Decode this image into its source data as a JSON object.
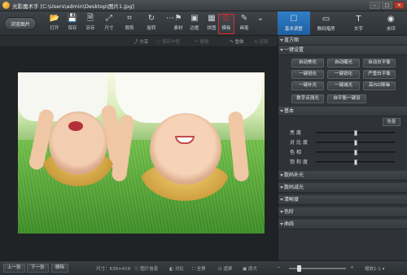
{
  "window": {
    "title": "光影魔术手 [C:\\Users\\admin\\Desktop\\图片1.jpg]",
    "controls": [
      "–",
      "□",
      "×"
    ]
  },
  "toolbar": {
    "browse_label": "浏览图片",
    "tools": [
      {
        "label": "打开",
        "icon": "folder-icon",
        "glyph": "📂"
      },
      {
        "label": "保存",
        "icon": "save-icon",
        "glyph": "💾"
      },
      {
        "label": "另存",
        "icon": "save-as-icon",
        "glyph": "🗎"
      },
      {
        "label": "尺寸",
        "icon": "resize-icon",
        "glyph": "⤢"
      },
      {
        "label": "裁剪",
        "icon": "crop-icon",
        "glyph": "⌗"
      },
      {
        "label": "旋转",
        "icon": "rotate-icon",
        "glyph": "↻"
      },
      {
        "label": "",
        "icon": "more-icon",
        "glyph": "⋯"
      },
      {
        "label": "素材",
        "icon": "material-icon",
        "glyph": "⚑"
      },
      {
        "label": "边框",
        "icon": "border-icon",
        "glyph": "▣"
      },
      {
        "label": "拼图",
        "icon": "collage-icon",
        "glyph": "▦"
      },
      {
        "label": "模板",
        "icon": "template-icon",
        "glyph": "⎙",
        "highlighted": true
      },
      {
        "label": "画笔",
        "icon": "brush-icon",
        "glyph": "✎"
      }
    ]
  },
  "right_tabs": [
    {
      "label": "基本调整",
      "icon": "adjust-icon",
      "glyph": "☐",
      "active": true
    },
    {
      "label": "数码暗房",
      "icon": "darkroom-icon",
      "glyph": "▭"
    },
    {
      "label": "文字",
      "icon": "text-icon",
      "glyph": "T"
    },
    {
      "label": "水印",
      "icon": "watermark-icon",
      "glyph": "◉"
    }
  ],
  "subbar": {
    "share": "分享",
    "save_template": "保存作图",
    "undo": "撤销",
    "redo": "重做",
    "restore": "还原"
  },
  "bottom": {
    "prev": "上一张",
    "next": "下一张",
    "delete": "删除",
    "size_info": "尺寸：639×419",
    "image_info": "图片信息",
    "compare": "对比",
    "fullscreen": "全屏",
    "fit": "适屏",
    "original": "原大",
    "zoom_label": "缩放1:1",
    "zoom_level": 0.15
  },
  "panel": {
    "histogram": "直方图",
    "one_click": "一键设置",
    "one_click_buttons": [
      "自动美化",
      "自动曝光",
      "自动白平衡",
      "一键锐化",
      "一键锐化",
      "严重白平衡",
      "一键补光",
      "一键减光",
      "高ISO降噪"
    ],
    "extra_buttons": [
      "数字点测光",
      "自平衡一键设"
    ],
    "basic": "基本",
    "reset": "恢复",
    "sliders": [
      {
        "label": "亮度",
        "value": 0.5
      },
      {
        "label": "对比度",
        "value": 0.5
      },
      {
        "label": "色相",
        "value": 0.5
      },
      {
        "label": "饱和度",
        "value": 0.5
      }
    ],
    "sections": [
      "数码补光",
      "数码减光",
      "清晰度",
      "色阶",
      "曲线"
    ]
  }
}
